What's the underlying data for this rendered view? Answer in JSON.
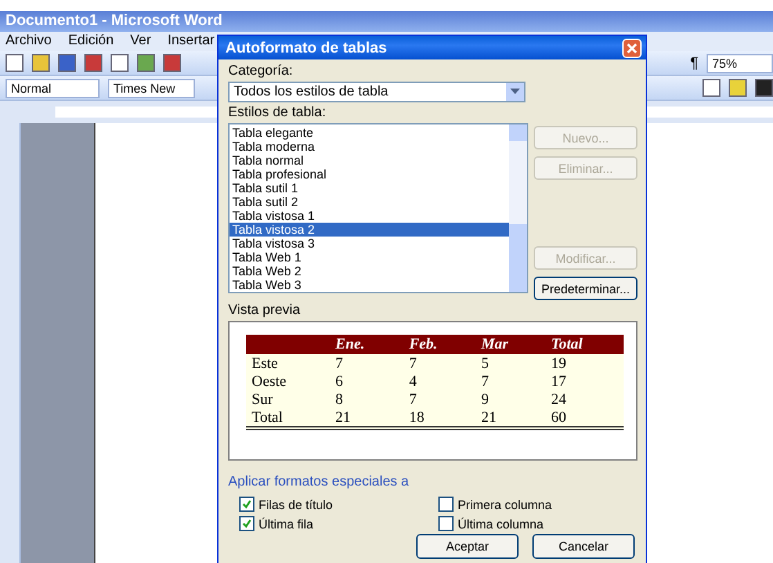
{
  "word": {
    "title": "Documento1 - Microsoft Word",
    "menu": [
      "Archivo",
      "Edición",
      "Ver",
      "Insertar"
    ],
    "style_box": "Normal",
    "font_box": "Times New",
    "pilcrow": "¶",
    "zoom": "75%"
  },
  "dialog": {
    "title": "Autoformato de tablas",
    "category_label": "Categoría:",
    "category_value": "Todos los estilos de tabla",
    "styles_label": "Estilos de tabla:",
    "styles": [
      {
        "label": "Tabla elegante",
        "selected": false
      },
      {
        "label": "Tabla moderna",
        "selected": false
      },
      {
        "label": "Tabla normal",
        "selected": false
      },
      {
        "label": "Tabla profesional",
        "selected": false
      },
      {
        "label": "Tabla sutil 1",
        "selected": false
      },
      {
        "label": "Tabla sutil 2",
        "selected": false
      },
      {
        "label": "Tabla vistosa 1",
        "selected": false
      },
      {
        "label": "Tabla vistosa 2",
        "selected": true
      },
      {
        "label": "Tabla vistosa 3",
        "selected": false
      },
      {
        "label": "Tabla Web 1",
        "selected": false
      },
      {
        "label": "Tabla Web 2",
        "selected": false
      },
      {
        "label": "Tabla Web 3",
        "selected": false
      }
    ],
    "side_buttons": [
      {
        "label": "Nuevo...",
        "disabled": true
      },
      {
        "label": "Eliminar...",
        "disabled": true
      },
      {
        "label": "Modificar...",
        "disabled": true
      },
      {
        "label": "Predeterminar...",
        "disabled": false
      }
    ],
    "preview_label": "Vista previa",
    "preview": {
      "columns": [
        "",
        "Ene.",
        "Feb.",
        "Mar",
        "Total"
      ],
      "rows": [
        [
          "Este",
          "7",
          "7",
          "5",
          "19"
        ],
        [
          "Oeste",
          "6",
          "4",
          "7",
          "17"
        ],
        [
          "Sur",
          "8",
          "7",
          "9",
          "24"
        ],
        [
          "Total",
          "21",
          "18",
          "21",
          "60"
        ]
      ]
    },
    "special_label": "Aplicar formatos especiales a",
    "options": [
      {
        "label": "Filas de título",
        "checked": true
      },
      {
        "label": "Última fila",
        "checked": true
      },
      {
        "label": "Primera columna",
        "checked": false
      },
      {
        "label": "Última columna",
        "checked": false
      }
    ],
    "buttons": [
      "Aceptar",
      "Cancelar"
    ]
  }
}
